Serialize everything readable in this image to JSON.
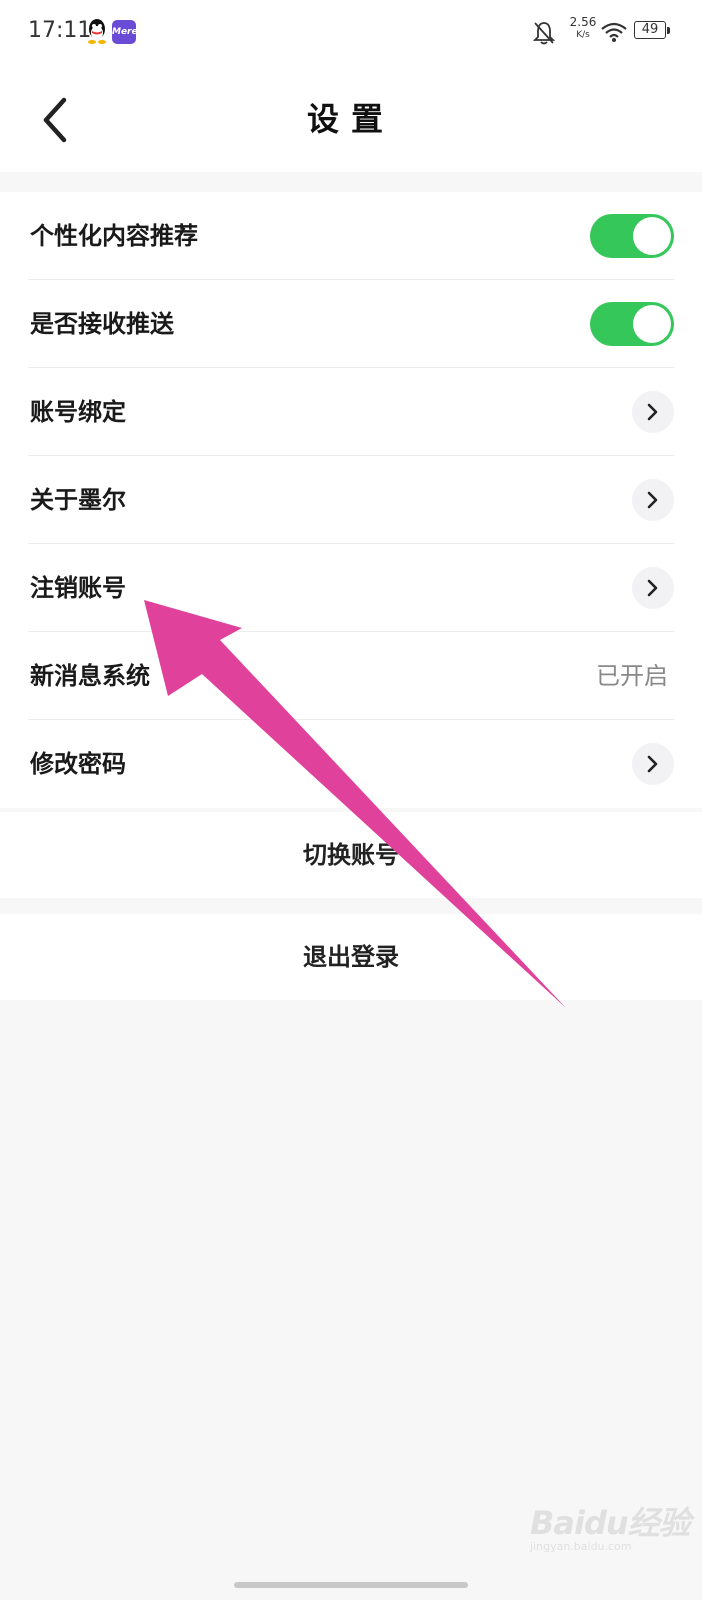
{
  "status_bar": {
    "time": "17:11",
    "app_icon_text": "Mere",
    "net_speed_value": "2.56",
    "net_speed_unit": "K/s",
    "battery": "49"
  },
  "header": {
    "title": "设置"
  },
  "settings": [
    {
      "label": "个性化内容推荐",
      "control": "toggle",
      "on": true
    },
    {
      "label": "是否接收推送",
      "control": "toggle",
      "on": true
    },
    {
      "label": "账号绑定",
      "control": "chevron"
    },
    {
      "label": "关于墨尔",
      "control": "chevron"
    },
    {
      "label": "注销账号",
      "control": "chevron"
    },
    {
      "label": "新消息系统",
      "control": "value",
      "value": "已开启"
    },
    {
      "label": "修改密码",
      "control": "chevron"
    }
  ],
  "actions": {
    "switch_account": "切换账号",
    "logout": "退出登录"
  },
  "watermark": {
    "logo": "Baidu经验",
    "url": "jingyan.baidu.com"
  },
  "colors": {
    "toggle_on": "#35c759",
    "annotation_arrow": "#e0419a"
  }
}
